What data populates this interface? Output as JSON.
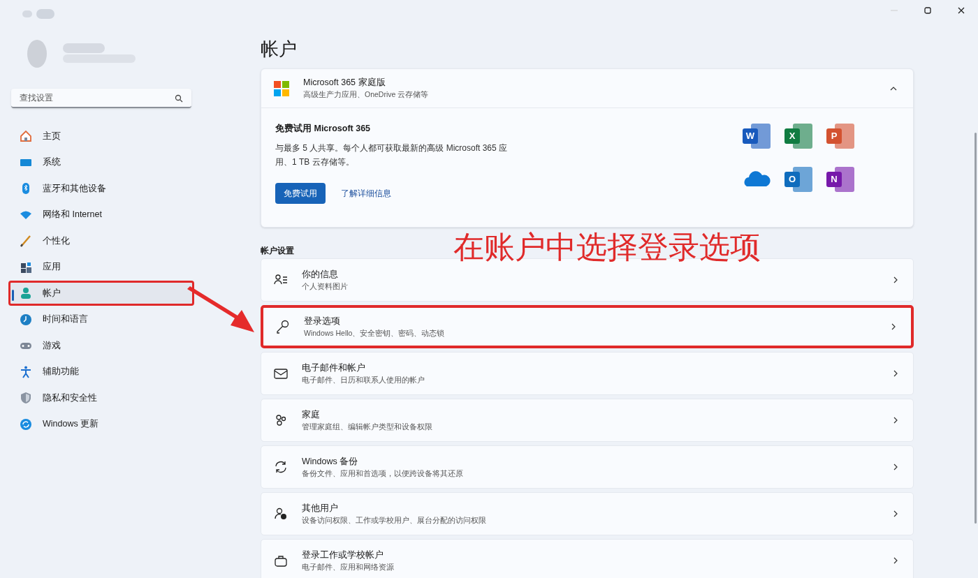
{
  "search": {
    "placeholder": "查找设置"
  },
  "nav": [
    {
      "label": "主页",
      "kind": "home",
      "selected": false,
      "highlighted": false
    },
    {
      "label": "系统",
      "kind": "system",
      "selected": false,
      "highlighted": false
    },
    {
      "label": "蓝牙和其他设备",
      "kind": "bluetooth",
      "selected": false,
      "highlighted": false
    },
    {
      "label": "网络和 Internet",
      "kind": "network",
      "selected": false,
      "highlighted": false
    },
    {
      "label": "个性化",
      "kind": "brush",
      "selected": false,
      "highlighted": false
    },
    {
      "label": "应用",
      "kind": "apps",
      "selected": false,
      "highlighted": false
    },
    {
      "label": "帐户",
      "kind": "account",
      "selected": true,
      "highlighted": true
    },
    {
      "label": "时间和语言",
      "kind": "time",
      "selected": false,
      "highlighted": false
    },
    {
      "label": "游戏",
      "kind": "game",
      "selected": false,
      "highlighted": false
    },
    {
      "label": "辅助功能",
      "kind": "access",
      "selected": false,
      "highlighted": false
    },
    {
      "label": "隐私和安全性",
      "kind": "shield",
      "selected": false,
      "highlighted": false
    },
    {
      "label": "Windows 更新",
      "kind": "update",
      "selected": false,
      "highlighted": false
    }
  ],
  "page_title": "帐户",
  "m365": {
    "title": "Microsoft 365 家庭版",
    "subtitle": "高级生产力应用、OneDrive 云存储等",
    "expanded": true,
    "heading": "免费试用 Microsoft 365",
    "body": "与最多 5 人共享。每个人都可获取最新的高级 Microsoft 365 应用、1 TB 云存储等。",
    "primary_button": "免费试用",
    "link": "了解详细信息",
    "apps": [
      {
        "letter": "W",
        "color": "#185abd"
      },
      {
        "letter": "X",
        "color": "#107c41"
      },
      {
        "letter": "P",
        "color": "#d35230"
      },
      {
        "kind": "cloud",
        "color": "#0f78d4"
      },
      {
        "letter": "O",
        "color": "#0f6cbd"
      },
      {
        "letter": "N",
        "color": "#7719aa"
      }
    ]
  },
  "section_label": "帐户设置",
  "annotation": "在账户中选择登录选项",
  "rows": [
    {
      "kind": "info",
      "title": "你的信息",
      "subtitle": "个人资料图片",
      "highlighted": false
    },
    {
      "kind": "key",
      "title": "登录选项",
      "subtitle": "Windows Hello、安全密钥、密码、动态锁",
      "highlighted": true
    },
    {
      "kind": "mail",
      "title": "电子邮件和帐户",
      "subtitle": "电子邮件、日历和联系人使用的帐户",
      "highlighted": false
    },
    {
      "kind": "family",
      "title": "家庭",
      "subtitle": "管理家庭组、编辑帐户类型和设备权限",
      "highlighted": false
    },
    {
      "kind": "sync",
      "title": "Windows 备份",
      "subtitle": "备份文件、应用和首选项，以便跨设备将其还原",
      "highlighted": false
    },
    {
      "kind": "users",
      "title": "其他用户",
      "subtitle": "设备访问权限、工作或学校用户、展台分配的访问权限",
      "highlighted": false
    },
    {
      "kind": "bag",
      "title": "登录工作或学校帐户",
      "subtitle": "电子邮件、应用和网络资源",
      "highlighted": false
    }
  ]
}
